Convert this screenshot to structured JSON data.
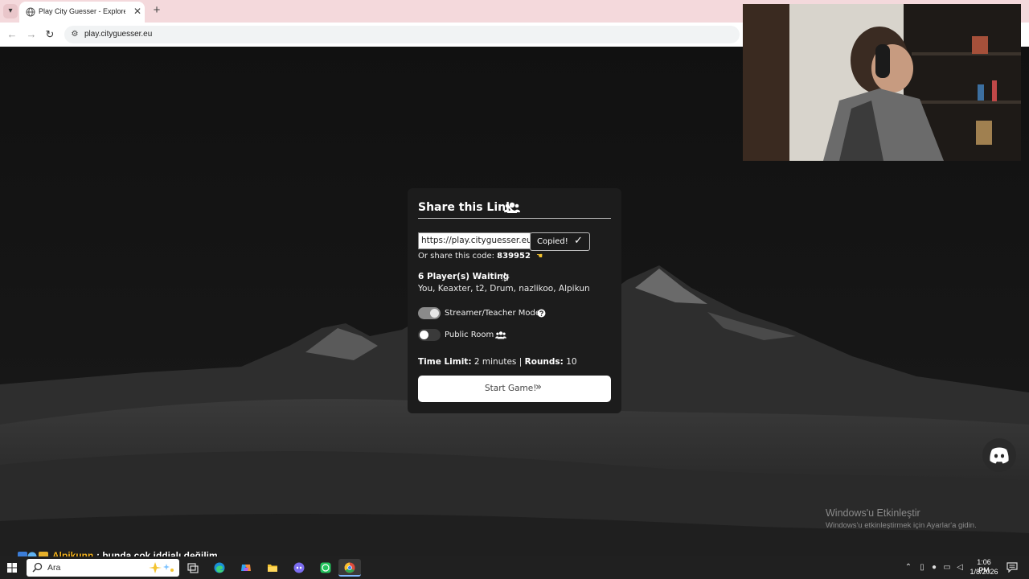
{
  "browser": {
    "tab_title": "Play City Guesser - Explore the W",
    "url": "play.cityguesser.eu",
    "icons": {
      "tab_list": "chevron-down-icon",
      "tab_favicon": "globe-icon",
      "close": "close-icon",
      "new_tab": "plus-icon",
      "back": "arrow-left-icon",
      "forward": "arrow-right-icon",
      "reload": "reload-icon",
      "site_info": "tune-icon"
    }
  },
  "share_card": {
    "title": "Share this Link",
    "title_icon": "users-icon",
    "link_value": "https://play.cityguesser.eu/",
    "copy_button_label": "Copied!",
    "copy_button_icon": "check-icon",
    "code_prefix": "Or share this code:",
    "code": "839952",
    "code_icon": "pointing-hand-icon",
    "players_title": "6 Player(s) Waiting",
    "players_icon": "spinner-icon",
    "players_list": "You, Keaxter, t2, Drum, nazlikoo, Alpikun",
    "streamer_mode_label": "Streamer/Teacher Mode",
    "streamer_mode_on": true,
    "streamer_mode_icon": "question-circle-icon",
    "public_room_label": "Public Room",
    "public_room_on": false,
    "public_room_icon": "users-icon",
    "time_limit_label": "Time Limit:",
    "time_limit_value": "2 minutes",
    "separator": "|",
    "rounds_label": "Rounds:",
    "rounds_value": "10",
    "start_button_label": "Start Game!",
    "start_button_icon": "double-chevron-right-icon"
  },
  "floating": {
    "discord_icon": "discord-icon"
  },
  "watermark": {
    "title": "Windows'u Etkinleştir",
    "subtitle": "Windows'u etkinleştirmek için Ayarlar'a gidin."
  },
  "chat": {
    "username": "Alpikunn",
    "message": ": bunda çok iddialı değilim,"
  },
  "taskbar": {
    "search_placeholder": "Ara",
    "time": "1:06 PM",
    "date": "1/8/2026",
    "apps": [
      "task-view-icon",
      "edge-icon",
      "copilot-icon",
      "file-explorer-icon",
      "discord-icon",
      "whatsapp-icon",
      "chrome-icon"
    ],
    "active_app": "chrome-icon",
    "tray": [
      "chevron-up-icon",
      "battery-saver-icon",
      "microphone-icon",
      "network-icon",
      "volume-icon"
    ]
  },
  "colors": {
    "tab_bar": "#f4d9dc",
    "card_bg": "#1c1c1c",
    "chat_username": "#f3b21e",
    "taskbar": "#202020"
  }
}
